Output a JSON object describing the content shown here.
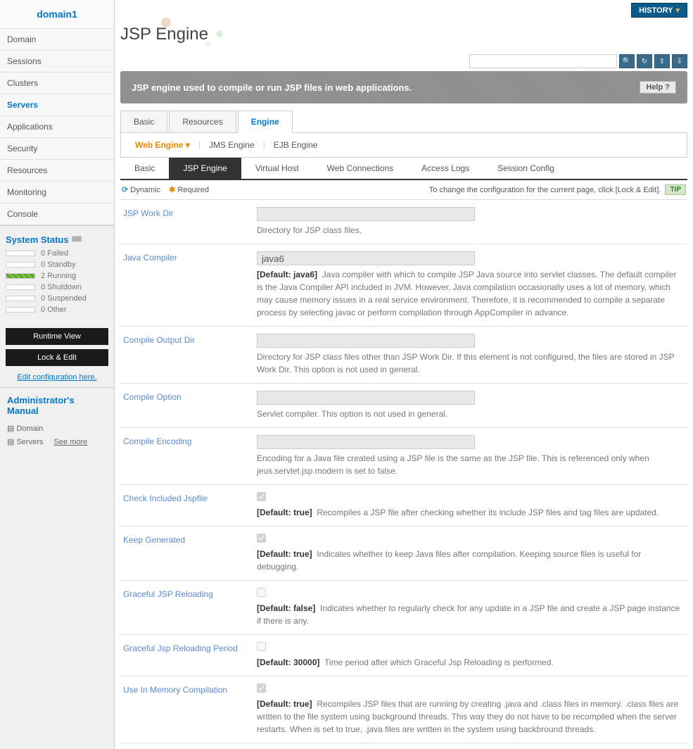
{
  "domain_name": "domain1",
  "nav": [
    {
      "label": "Domain",
      "active": false
    },
    {
      "label": "Sessions",
      "active": false
    },
    {
      "label": "Clusters",
      "active": false
    },
    {
      "label": "Servers",
      "active": true
    },
    {
      "label": "Applications",
      "active": false
    },
    {
      "label": "Security",
      "active": false
    },
    {
      "label": "Resources",
      "active": false
    },
    {
      "label": "Monitoring",
      "active": false
    },
    {
      "label": "Console",
      "active": false
    }
  ],
  "system_status": {
    "header": "System Status",
    "items": [
      {
        "count": "0",
        "label": "Failed",
        "cls": ""
      },
      {
        "count": "0",
        "label": "Standby",
        "cls": ""
      },
      {
        "count": "2",
        "label": "Running",
        "cls": "running"
      },
      {
        "count": "0",
        "label": "Shutdown",
        "cls": ""
      },
      {
        "count": "0",
        "label": "Suspended",
        "cls": ""
      },
      {
        "count": "0",
        "label": "Other",
        "cls": ""
      }
    ]
  },
  "buttons": {
    "runtime_view": "Runtime View",
    "lock_edit": "Lock & Edit",
    "edit_config": "Edit configuration here."
  },
  "admin_manual": {
    "header": "Administrator's Manual",
    "items": [
      "Domain",
      "Servers"
    ],
    "see_more": "See more"
  },
  "history_label": "HISTORY",
  "page_title": "JSP Engine",
  "desc_bar": "JSP engine used to compile or run JSP files in web applications.",
  "help_label": "Help",
  "tabs1": [
    {
      "label": "Basic",
      "active": false
    },
    {
      "label": "Resources",
      "active": false
    },
    {
      "label": "Engine",
      "active": true
    }
  ],
  "tabs2": [
    {
      "label": "Web Engine",
      "active": true
    },
    {
      "label": "JMS Engine",
      "active": false
    },
    {
      "label": "EJB Engine",
      "active": false
    }
  ],
  "tabs3": [
    {
      "label": "Basic",
      "active": false
    },
    {
      "label": "JSP Engine",
      "active": true
    },
    {
      "label": "Virtual Host",
      "active": false
    },
    {
      "label": "Web Connections",
      "active": false
    },
    {
      "label": "Access Logs",
      "active": false
    },
    {
      "label": "Session Config",
      "active": false
    }
  ],
  "legend": {
    "dynamic": "Dynamic",
    "required": "Required",
    "tip_text": "To change the configuration for the current page, click [Lock & Edit].",
    "tip_label": "TIP"
  },
  "form": [
    {
      "label": "JSP Work Dir",
      "type": "text",
      "value": "",
      "desc": "Directory for JSP class files."
    },
    {
      "label": "Java Compiler",
      "type": "text",
      "value": "java6",
      "default": "[Default: java6]",
      "desc": "Java compiler with which to compile JSP Java source into servlet classes. The default compiler is the Java Compiler API included in JVM. However, Java compilation occasionally uses a lot of memory, which may cause memory issues in a real service environment. Therefore, it is recommended to compile a separate process by selecting javac or perform compilation through AppCompiler in advance."
    },
    {
      "label": "Compile Output Dir",
      "type": "text",
      "value": "",
      "desc": "Directory for JSP class files other than JSP Work Dir. If this element is not configured, the files are stored in JSP Work Dir. This option is not used in general."
    },
    {
      "label": "Compile Option",
      "type": "text",
      "value": "",
      "desc": "Servlet compiler. This option is not used in general."
    },
    {
      "label": "Compile Encoding",
      "type": "text",
      "value": "",
      "desc": "Encoding for a Java file created using a JSP file is the same as the JSP file. This is referenced only when jeus.servlet.jsp.modern is set to false."
    },
    {
      "label": "Check Included Jspfile",
      "type": "check",
      "checked": true,
      "default": "[Default: true]",
      "desc": "Recompiles a JSP file after checking whether its include JSP files and tag files are updated."
    },
    {
      "label": "Keep Generated",
      "type": "check",
      "checked": true,
      "default": "[Default: true]",
      "desc": "Indicates whether to keep Java files after compilation. Keeping source files is useful for debugging."
    },
    {
      "label": "Graceful JSP Reloading",
      "type": "check",
      "checked": false,
      "default": "[Default: false]",
      "desc": "Indicates whether to regularly check for any update in a JSP file and create a JSP page instance if there is any."
    },
    {
      "label": "Graceful Jsp Reloading Period",
      "type": "check",
      "checked": false,
      "default": "[Default: 30000]",
      "desc": "Time period after which Graceful Jsp Reloading is performed."
    },
    {
      "label": "Use In Memory Compilation",
      "type": "check",
      "checked": true,
      "default": "[Default: true]",
      "desc": "Recompiles JSP files that are running by creating .java and .class files in memory. .class files are written to the file system using background threads. This way they do not have to be recompiled when the server restarts. When <keep-generated> is set to true, .java files are written in the system using backbround threads."
    }
  ]
}
